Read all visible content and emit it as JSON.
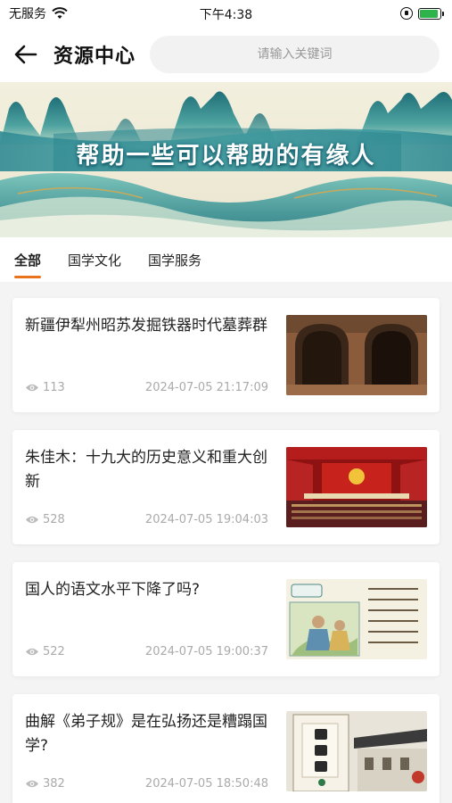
{
  "status": {
    "carrier": "无服务",
    "time": "下午4:38",
    "battery_level": 0.9,
    "battery_color": "#2db34a"
  },
  "header": {
    "title": "资源中心",
    "search_placeholder": "请输入关键词"
  },
  "banner": {
    "text": "帮助一些可以帮助的有缘人"
  },
  "tabs": [
    {
      "label": "全部",
      "active": true
    },
    {
      "label": "国学文化",
      "active": false
    },
    {
      "label": "国学服务",
      "active": false
    }
  ],
  "accent_color": "#e8731c",
  "articles": [
    {
      "title": "新疆伊犁州昭苏发掘铁器时代墓葬群",
      "views": "113",
      "date": "2024-07-05 21:17:09",
      "thumb": "tomb-photo"
    },
    {
      "title": "朱佳木：十九大的历史意义和重大创新",
      "views": "528",
      "date": "2024-07-05 19:04:03",
      "thumb": "congress-hall-photo"
    },
    {
      "title": "国人的语文水平下降了吗?",
      "views": "522",
      "date": "2024-07-05 19:00:37",
      "thumb": "ancient-poem-illustration"
    },
    {
      "title": "曲解《弟子规》是在弘扬还是糟蹋国学?",
      "views": "382",
      "date": "2024-07-05 18:50:48",
      "thumb": "dizigui-book-cover"
    }
  ]
}
